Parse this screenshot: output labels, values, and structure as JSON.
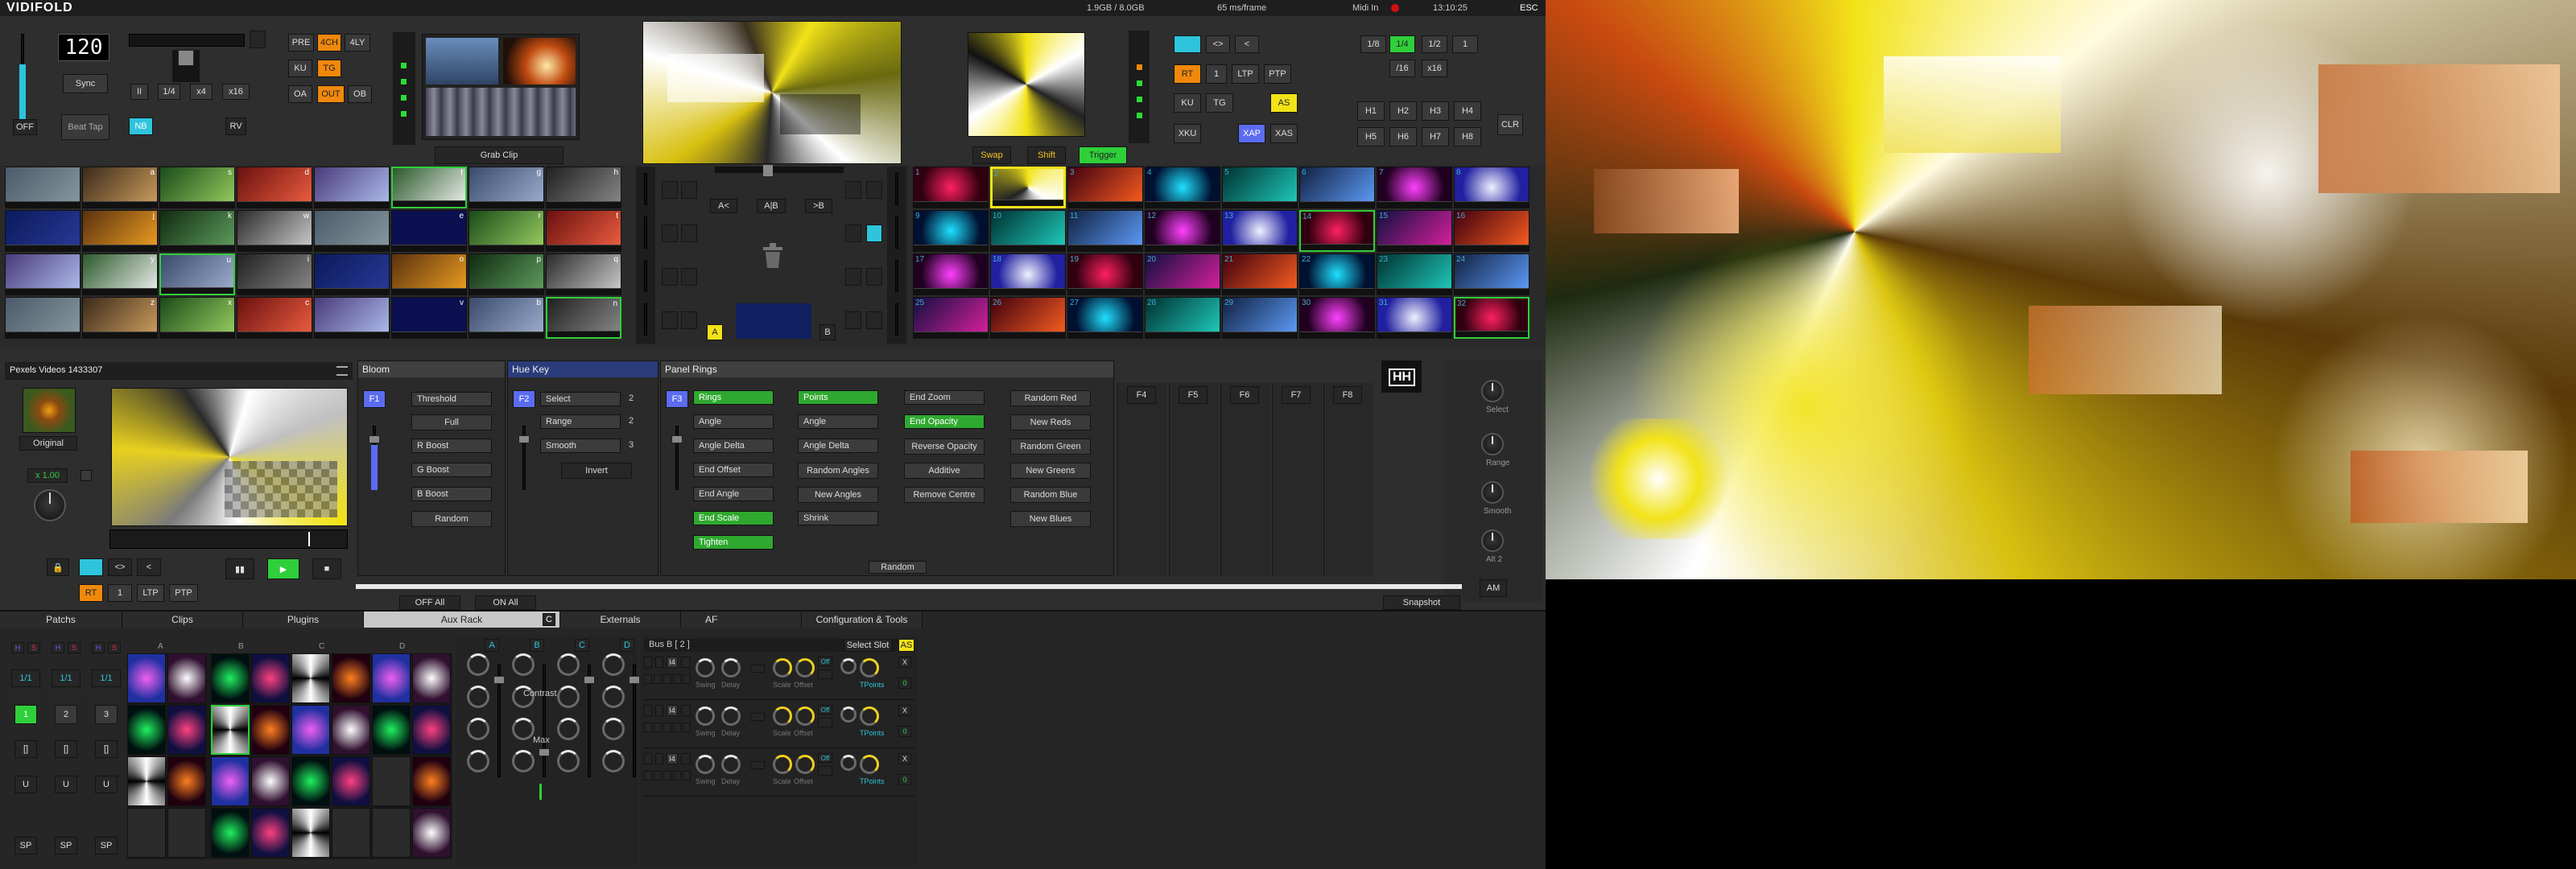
{
  "app": {
    "title": "VIDIFOLD",
    "memory": "1.9GB / 8.0GB",
    "frame_time": "65 ms/frame",
    "midi": "Midi In",
    "clock": "13:10:25",
    "esc": "ESC"
  },
  "tempo": {
    "bpm": "120",
    "sync": "Sync",
    "beat_tap": "Beat Tap",
    "off": "OFF",
    "nb": "NB",
    "rv": "RV",
    "rates": [
      "II",
      "1/4",
      "x4",
      "x16"
    ]
  },
  "layout_modes": {
    "row1": [
      "PRE",
      "4CH",
      "4LY"
    ],
    "row2": [
      "KU",
      "TG"
    ],
    "row3": [
      "OA",
      "OUT",
      "OB"
    ]
  },
  "grab_clip": "Grab Clip",
  "transport": {
    "swap": "Swap",
    "shift": "Shift",
    "trigger": "Trigger"
  },
  "mix_modes": {
    "row1": [
      "<>",
      "<"
    ],
    "row2": [
      "RT",
      "1",
      "LTP",
      "PTP"
    ],
    "row3": [
      "KU",
      "TG",
      "AS"
    ],
    "row4": [
      "XKU",
      "XAP",
      "XAS"
    ]
  },
  "rate_grid": {
    "row1": [
      "1/8",
      "1/4",
      "1/2",
      "1"
    ],
    "row2": [
      "/16",
      "x16"
    ]
  },
  "hot_slots": {
    "row1": [
      "H1",
      "H2",
      "H3",
      "H4"
    ],
    "row2": [
      "H5",
      "H6",
      "H7",
      "H8"
    ],
    "clr": "CLR"
  },
  "crossfader": {
    "a": "A<",
    "ab": "A|B",
    "b": ">B",
    "a_label": "A",
    "b_label": "B"
  },
  "bank_a_letters": [
    "a",
    "s",
    "d",
    "f",
    "g",
    "h",
    "j",
    "k",
    "w",
    "e",
    "r",
    "t",
    "y",
    "u",
    "i",
    "o",
    "p",
    "q",
    "z",
    "x",
    "c",
    "v",
    "b",
    "n",
    "m"
  ],
  "bank_b_numbers": [
    "1",
    "2",
    "3",
    "4",
    "5",
    "6",
    "7",
    "8",
    "9",
    "10",
    "11",
    "12",
    "13",
    "14",
    "15",
    "16",
    "17",
    "18",
    "19",
    "20",
    "21",
    "22",
    "23",
    "24",
    "25",
    "26",
    "27",
    "28",
    "29",
    "30",
    "31",
    "32"
  ],
  "source": {
    "name": "Pexels Videos 1433307",
    "original": "Original",
    "speed": "x 1.00",
    "controls": [
      "RT",
      "1",
      "LTP",
      "PTP"
    ],
    "nav": [
      "<>",
      "<"
    ]
  },
  "effects": {
    "bloom": {
      "title": "Bloom",
      "f": "F1",
      "items": [
        "Threshold",
        "Full",
        "R Boost",
        "G Boost",
        "B Boost"
      ],
      "random": "Random"
    },
    "hue_key": {
      "title": "Hue Key",
      "f": "F2",
      "items": [
        "Select",
        "Range",
        "Smooth"
      ],
      "values": [
        "2",
        "2",
        "3"
      ],
      "invert": "Invert"
    },
    "panel_rings": {
      "title": "Panel Rings",
      "f": "F3",
      "col1": [
        "Rings",
        "Angle",
        "Angle Delta",
        "End Offset",
        "End Angle",
        "End Scale",
        "Tighten"
      ],
      "col2": [
        "Points",
        "Angle",
        "Angle Delta",
        "Random Angles",
        "New Angles",
        "Shrink"
      ],
      "col3": [
        "End Zoom",
        "End Opacity",
        "Reverse Opacity",
        "Additive",
        "Remove Centre"
      ],
      "col4": [
        "Random Red",
        "New Reds",
        "Random Green",
        "New Greens",
        "Random Blue",
        "New Blues"
      ],
      "random": "Random"
    },
    "slots": [
      "F4",
      "F5",
      "F6",
      "F7",
      "F8"
    ],
    "off_all": "OFF All",
    "on_all": "ON All",
    "snapshot": "Snapshot",
    "knobs": [
      "Select",
      "Range",
      "Smooth",
      "Alt 2"
    ],
    "am": "AM",
    "logo": "HH"
  },
  "tabs": [
    "Patchs",
    "Clips",
    "Plugins",
    "Aux Rack",
    "Externals",
    "AF",
    "Configuration & Tools"
  ],
  "tab_c": "C",
  "patchs": {
    "rates": [
      "1/1",
      "1/1",
      "1/1"
    ],
    "nums": [
      "1",
      "2",
      "3"
    ],
    "brackets": [
      "[]",
      "[]",
      "[]"
    ],
    "u": [
      "U",
      "U",
      "U"
    ],
    "sp": [
      "SP",
      "SP",
      "SP"
    ],
    "hs": [
      "H",
      "S"
    ]
  },
  "clips_cols": [
    "A",
    "B",
    "C",
    "D"
  ],
  "mixer": {
    "channels": [
      "A",
      "B",
      "C",
      "D"
    ],
    "contrast": "Contrast",
    "max": "Max"
  },
  "bus": {
    "title": "Bus B [ 2 ]",
    "select": "Select Slot",
    "as": "AS",
    "row_labels": [
      "Swing",
      "Delay",
      "Scale",
      "Offset",
      "TPoints"
    ],
    "oe": "Off",
    "val": "0",
    "x": "X",
    "num": "I4"
  },
  "colors": {
    "accent_cyan": "#2ec4dc",
    "active_green": "#2fcf3a",
    "highlight_yellow": "#f2e318",
    "orange": "#f0880c"
  }
}
